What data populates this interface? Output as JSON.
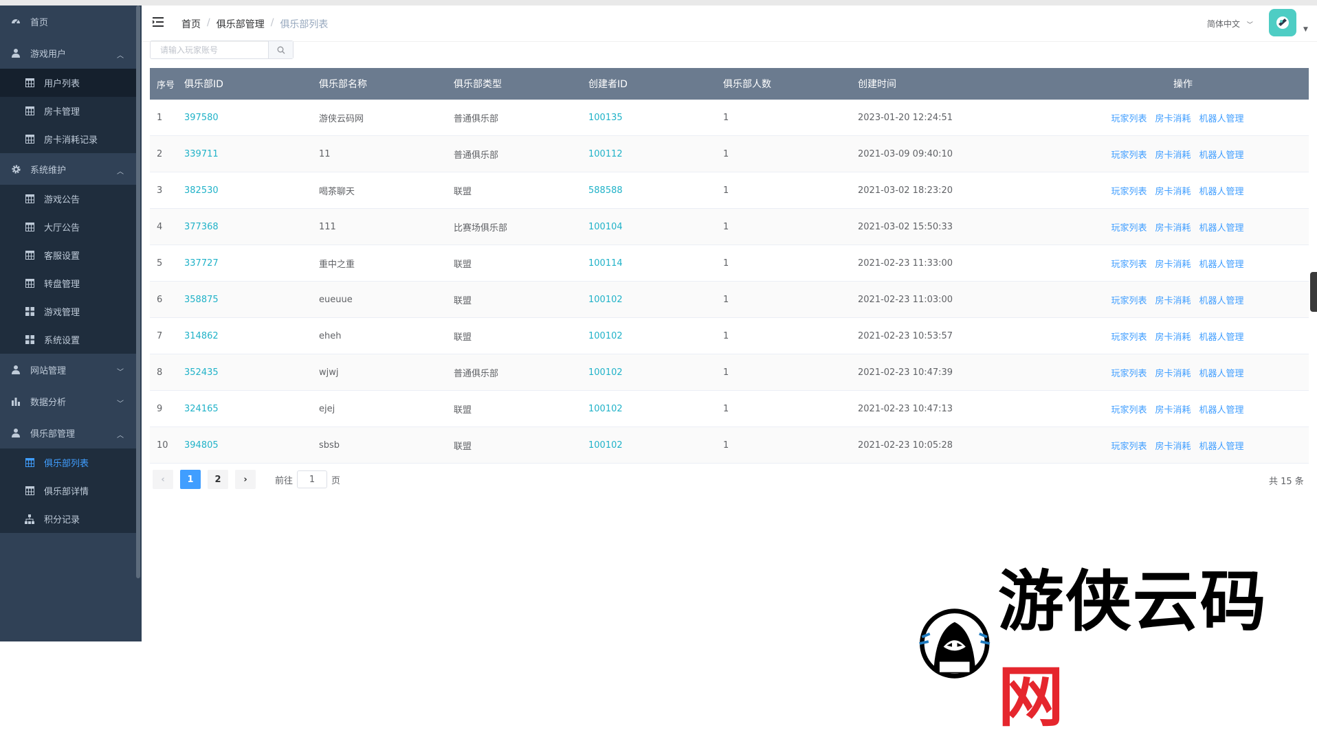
{
  "sidebar": {
    "items": [
      {
        "label": "首页",
        "icon": "dashboard-icon",
        "level": "top",
        "arrow": ""
      },
      {
        "label": "游戏用户",
        "icon": "user-icon",
        "level": "top",
        "arrow": "up"
      },
      {
        "label": "用户列表",
        "icon": "table-icon",
        "level": "sub",
        "active_bg": true
      },
      {
        "label": "房卡管理",
        "icon": "table-icon",
        "level": "sub"
      },
      {
        "label": "房卡消耗记录",
        "icon": "table-icon",
        "level": "sub"
      },
      {
        "label": "系统维护",
        "icon": "gear-icon",
        "level": "top",
        "arrow": "up"
      },
      {
        "label": "游戏公告",
        "icon": "table-icon",
        "level": "sub"
      },
      {
        "label": "大厅公告",
        "icon": "table-icon",
        "level": "sub"
      },
      {
        "label": "客服设置",
        "icon": "table-icon",
        "level": "sub"
      },
      {
        "label": "转盘管理",
        "icon": "table-icon",
        "level": "sub"
      },
      {
        "label": "游戏管理",
        "icon": "grid-icon",
        "level": "sub"
      },
      {
        "label": "系统设置",
        "icon": "grid-icon",
        "level": "sub"
      },
      {
        "label": "网站管理",
        "icon": "user-icon",
        "level": "top",
        "arrow": "down"
      },
      {
        "label": "数据分析",
        "icon": "bar-chart-icon",
        "level": "top",
        "arrow": "down"
      },
      {
        "label": "俱乐部管理",
        "icon": "user-icon",
        "level": "top",
        "arrow": "up"
      },
      {
        "label": "俱乐部列表",
        "icon": "table-icon",
        "level": "sub",
        "active": true
      },
      {
        "label": "俱乐部详情",
        "icon": "table-icon",
        "level": "sub"
      },
      {
        "label": "积分记录",
        "icon": "tree-icon",
        "level": "sub"
      }
    ]
  },
  "header": {
    "breadcrumb": [
      "首页",
      "俱乐部管理",
      "俱乐部列表"
    ],
    "language": "简体中文"
  },
  "search": {
    "placeholder": "请输入玩家账号",
    "value": ""
  },
  "table": {
    "columns": [
      "序号",
      "俱乐部ID",
      "俱乐部名称",
      "俱乐部类型",
      "创建者ID",
      "俱乐部人数",
      "创建时间",
      "操作"
    ],
    "rows": [
      {
        "no": "1",
        "club_id": "397580",
        "name": "游侠云码网",
        "type": "普通俱乐部",
        "creator": "100135",
        "members": "1",
        "created": "2023-01-20 12:24:51"
      },
      {
        "no": "2",
        "club_id": "339711",
        "name": "11",
        "type": "普通俱乐部",
        "creator": "100112",
        "members": "1",
        "created": "2021-03-09 09:40:10"
      },
      {
        "no": "3",
        "club_id": "382530",
        "name": "喝茶聊天",
        "type": "联盟",
        "creator": "588588",
        "members": "1",
        "created": "2021-03-02 18:23:20"
      },
      {
        "no": "4",
        "club_id": "377368",
        "name": "111",
        "type": "比赛场俱乐部",
        "creator": "100104",
        "members": "1",
        "created": "2021-03-02 15:50:33"
      },
      {
        "no": "5",
        "club_id": "337727",
        "name": "重中之重",
        "type": "联盟",
        "creator": "100114",
        "members": "1",
        "created": "2021-02-23 11:33:00"
      },
      {
        "no": "6",
        "club_id": "358875",
        "name": "eueuue",
        "type": "联盟",
        "creator": "100102",
        "members": "1",
        "created": "2021-02-23 11:03:00"
      },
      {
        "no": "7",
        "club_id": "314862",
        "name": "eheh",
        "type": "联盟",
        "creator": "100102",
        "members": "1",
        "created": "2021-02-23 10:53:57"
      },
      {
        "no": "8",
        "club_id": "352435",
        "name": "wjwj",
        "type": "普通俱乐部",
        "creator": "100102",
        "members": "1",
        "created": "2021-02-23 10:47:39"
      },
      {
        "no": "9",
        "club_id": "324165",
        "name": "ejej",
        "type": "联盟",
        "creator": "100102",
        "members": "1",
        "created": "2021-02-23 10:47:13"
      },
      {
        "no": "10",
        "club_id": "394805",
        "name": "sbsb",
        "type": "联盟",
        "creator": "100102",
        "members": "1",
        "created": "2021-02-23 10:05:28"
      }
    ],
    "actions": [
      "玩家列表",
      "房卡消耗",
      "机器人管理"
    ]
  },
  "pagination": {
    "pages": [
      "1",
      "2"
    ],
    "current": "1",
    "goto_prefix": "前往",
    "goto_value": "1",
    "goto_suffix": "页",
    "total": "共 15 条"
  },
  "watermark": {
    "text_black": "游侠云码",
    "text_red": "网"
  },
  "colors": {
    "sidebar": "#304156",
    "submenu": "#1f2d3d",
    "active": "#409eff",
    "table_header": "#6b7b8f",
    "teal_link": "#20b2c8"
  }
}
